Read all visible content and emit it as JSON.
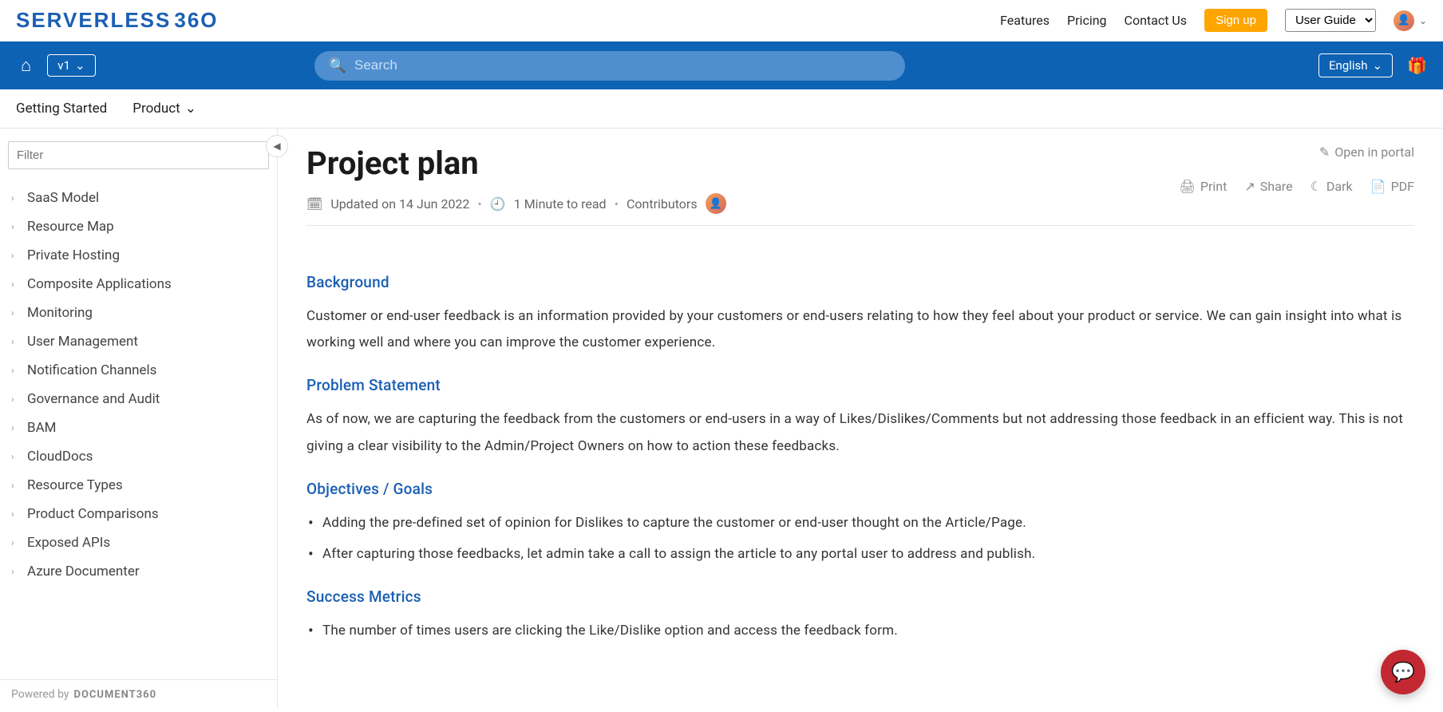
{
  "topnav": {
    "logo": "SERVERLESS",
    "logo_tail": "36O",
    "links": {
      "features": "Features",
      "pricing": "Pricing",
      "contact": "Contact Us"
    },
    "signup": "Sign up",
    "userguide": "User Guide"
  },
  "bluebar": {
    "version": "v1",
    "search_placeholder": "Search",
    "language": "English"
  },
  "subnav": {
    "getting_started": "Getting Started",
    "product": "Product"
  },
  "sidebar": {
    "filter_placeholder": "Filter",
    "items": [
      "SaaS Model",
      "Resource Map",
      "Private Hosting",
      "Composite Applications",
      "Monitoring",
      "User Management",
      "Notification Channels",
      "Governance and Audit",
      "BAM",
      "CloudDocs",
      "Resource Types",
      "Product Comparisons",
      "Exposed APIs",
      "Azure Documenter"
    ],
    "powered_by": "Powered by",
    "doc360": "DOCUMENT360"
  },
  "article": {
    "title": "Project plan",
    "open_in_portal": "Open in portal",
    "meta": {
      "updated": "Updated on 14 Jun 2022",
      "read": "1 Minute to read",
      "contributors_label": "Contributors"
    },
    "actions": {
      "print": "Print",
      "share": "Share",
      "dark": "Dark",
      "pdf": "PDF"
    },
    "sections": {
      "background_h": "Background",
      "background_p": "Customer or end-user feedback is an information provided by your customers or end-users relating to how they feel about your product or service. We can gain insight into what is working well and where you can improve the customer experience.",
      "problem_h": "Problem Statement",
      "problem_p": "As of now, we are capturing the feedback from the customers or end-users in a way of Likes/Dislikes/Comments but not addressing those feedback in an efficient way. This is not giving a clear visibility to the Admin/Project Owners on how to action these feedbacks.",
      "objectives_h": "Objectives / Goals",
      "objectives": [
        "Adding the pre-defined set of opinion for Dislikes to capture the customer or end-user thought on the Article/Page.",
        "After capturing those feedbacks, let admin take a call to assign the article to any portal user to address and publish."
      ],
      "metrics_h": "Success Metrics",
      "metrics": [
        "The number of times users are clicking the Like/Dislike option and access the feedback form."
      ]
    }
  }
}
